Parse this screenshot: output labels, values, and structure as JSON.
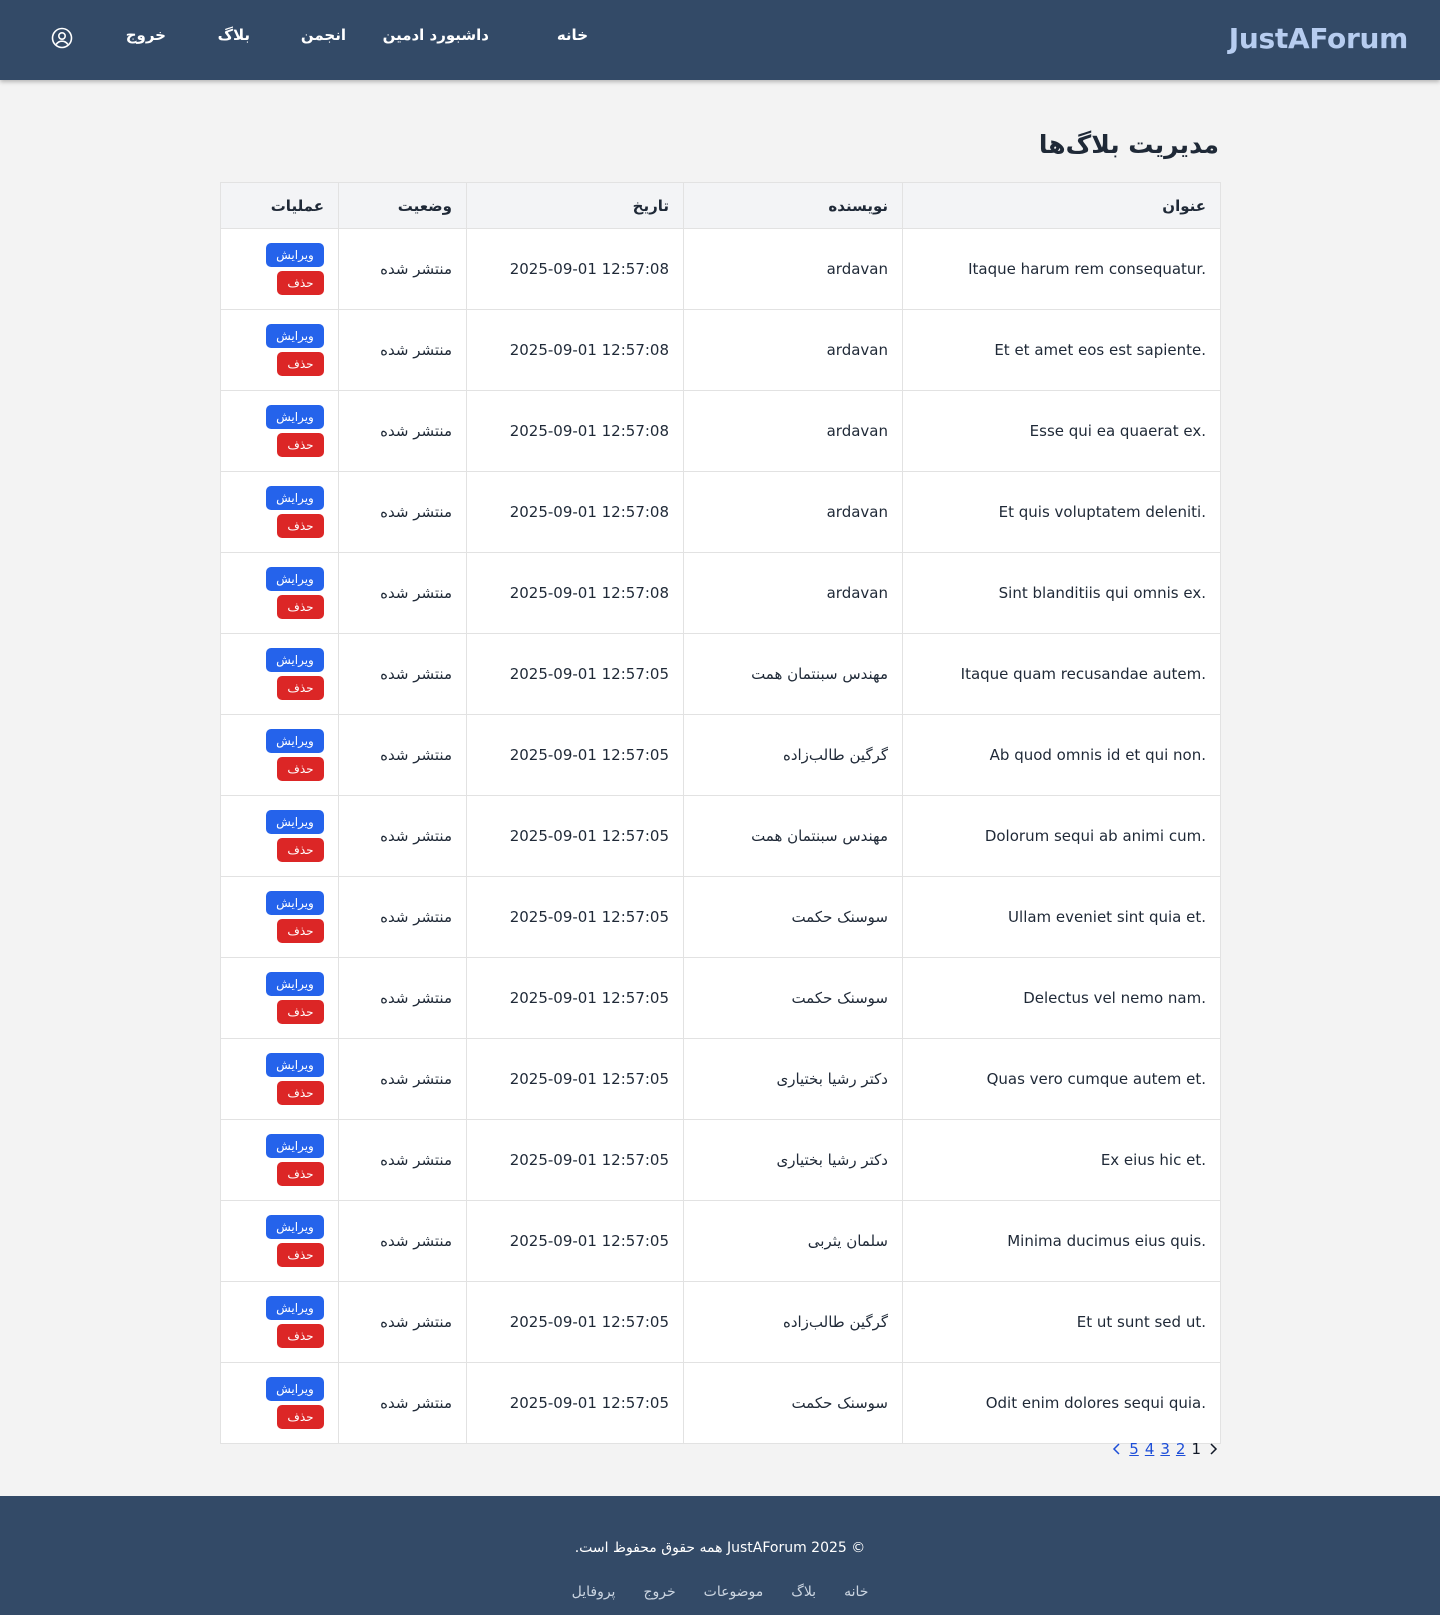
{
  "brand": "JustAForum",
  "nav": {
    "home": "خانه",
    "admin_dashboard": "داشبورد ادمین",
    "forum": "انجمن",
    "blog": "بلاگ",
    "logout": "خروج",
    "profile_icon": "user-circle-icon"
  },
  "page_title": "مدیریت بلاگ‌ها",
  "table": {
    "headers": {
      "title": "عنوان",
      "author": "نویسنده",
      "date": "تاریخ",
      "status": "وضعیت",
      "actions": "عملیات"
    },
    "edit_label": "ویرایش",
    "delete_label": "حذف",
    "rows": [
      {
        "title": "Itaque harum rem consequatur.",
        "author": "ardavan",
        "date": "2025-09-01 12:57:08",
        "status": "منتشر شده"
      },
      {
        "title": "Et et amet eos est sapiente.",
        "author": "ardavan",
        "date": "2025-09-01 12:57:08",
        "status": "منتشر شده"
      },
      {
        "title": "Esse qui ea quaerat ex.",
        "author": "ardavan",
        "date": "2025-09-01 12:57:08",
        "status": "منتشر شده"
      },
      {
        "title": "Et quis voluptatem deleniti.",
        "author": "ardavan",
        "date": "2025-09-01 12:57:08",
        "status": "منتشر شده"
      },
      {
        "title": "Sint blanditiis qui omnis ex.",
        "author": "ardavan",
        "date": "2025-09-01 12:57:08",
        "status": "منتشر شده"
      },
      {
        "title": "Itaque quam recusandae autem.",
        "author": "مهندس سبنتمان همت",
        "date": "2025-09-01 12:57:05",
        "status": "منتشر شده"
      },
      {
        "title": "Ab quod omnis id et qui non.",
        "author": "گرگین طالب‌زاده",
        "date": "2025-09-01 12:57:05",
        "status": "منتشر شده"
      },
      {
        "title": "Dolorum sequi ab animi cum.",
        "author": "مهندس سبنتمان همت",
        "date": "2025-09-01 12:57:05",
        "status": "منتشر شده"
      },
      {
        "title": "Ullam eveniet sint quia et.",
        "author": "سوسنک حکمت",
        "date": "2025-09-01 12:57:05",
        "status": "منتشر شده"
      },
      {
        "title": "Delectus vel nemo nam.",
        "author": "سوسنک حکمت",
        "date": "2025-09-01 12:57:05",
        "status": "منتشر شده"
      },
      {
        "title": "Quas vero cumque autem et.",
        "author": "دکتر رشیا بختیاری",
        "date": "2025-09-01 12:57:05",
        "status": "منتشر شده"
      },
      {
        "title": "Ex eius hic et.",
        "author": "دکتر رشیا بختیاری",
        "date": "2025-09-01 12:57:05",
        "status": "منتشر شده"
      },
      {
        "title": "Minima ducimus eius quis.",
        "author": "سلمان یثربی",
        "date": "2025-09-01 12:57:05",
        "status": "منتشر شده"
      },
      {
        "title": "Et ut sunt sed ut.",
        "author": "گرگین طالب‌زاده",
        "date": "2025-09-01 12:57:05",
        "status": "منتشر شده"
      },
      {
        "title": "Odit enim dolores sequi quia.",
        "author": "سوسنک حکمت",
        "date": "2025-09-01 12:57:05",
        "status": "منتشر شده"
      }
    ]
  },
  "pagination": {
    "current": "1",
    "pages": [
      "2",
      "3",
      "4",
      "5"
    ],
    "prev_icon": "chevron-right-icon",
    "next_icon": "chevron-left-icon"
  },
  "footer": {
    "copyright": "© 2025 JustAForum همه حقوق محفوظ است.",
    "links": [
      "خانه",
      "بلاگ",
      "موضوعات",
      "خروج",
      "پروفایل"
    ]
  },
  "colors": {
    "navbar_bg": "#334a67",
    "brand_text": "#b7cdf0",
    "edit_button": "#2563eb",
    "delete_button": "#dc2626",
    "page_bg": "#f3f3f3"
  }
}
